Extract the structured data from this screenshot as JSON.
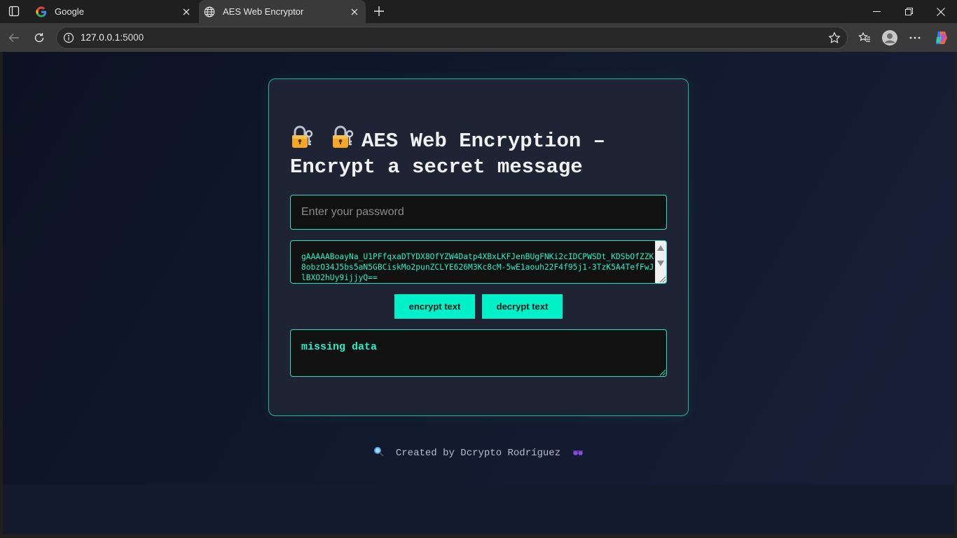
{
  "browser": {
    "tabs": [
      {
        "title": "Google",
        "icon": "google-icon"
      },
      {
        "title": "AES Web Encryptor",
        "icon": "globe-icon"
      }
    ],
    "url": {
      "host": "127.0.0.1",
      "port": ":5000"
    }
  },
  "page": {
    "heading": "AES Web Encryption – Encrypt a secret message",
    "password_placeholder": "Enter your password",
    "password_value": "",
    "ciphertext": "gAAAAABoayNa_U1PFfqxaDTYDX8OfYZW4Datp4XBxLKFJenBUgFNKi2cIDCPWSDt_KDSbOfZZK8obzO34J5bs5aN5GBCiskMo2punZCLYE626M3Kc8cM-5wE1aouh22F4f95j1-3TzK5A4TefFwJlBXO2hUy9ijjyQ==",
    "encrypt_label": "encrypt text",
    "decrypt_label": "decrypt text",
    "output": "missing data",
    "footer": "Created by Dcrypto Rodríguez"
  },
  "colors": {
    "accent": "#00f0c8",
    "card_bg": "#1e2433",
    "field_bg": "#111111"
  }
}
